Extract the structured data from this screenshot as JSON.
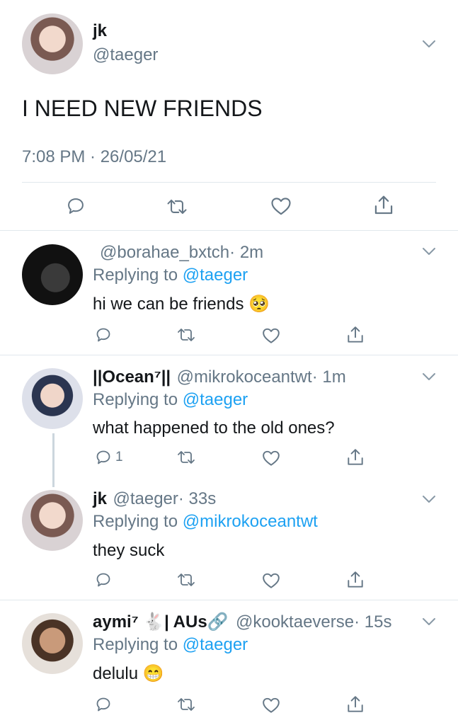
{
  "main_tweet": {
    "name": "jk",
    "handle": "@taeger",
    "text": "I NEED NEW FRIENDS",
    "timestamp": "7:08 PM · 26/05/21"
  },
  "replies": [
    {
      "name": "",
      "handle": "@borahae_bxtch",
      "time": "· 2m",
      "replying_prefix": "Replying to",
      "replying_to": "@taeger",
      "text": "hi we can be friends",
      "emoji": "🥺",
      "reply_count": ""
    },
    {
      "name": "||Ocean⁷||",
      "handle": "@mikrokoceantwt",
      "time": "· 1m",
      "replying_prefix": "Replying to",
      "replying_to": "@taeger",
      "text": "what happened to the old ones?",
      "emoji": "",
      "reply_count": "1"
    },
    {
      "name": "jk",
      "handle": "@taeger",
      "time": "· 33s",
      "replying_prefix": "Replying to",
      "replying_to": "@mikrokoceantwt",
      "text": "they suck",
      "emoji": "",
      "reply_count": ""
    },
    {
      "name": "aymi⁷ 🐇| AUs🔗",
      "handle": "@kooktaeverse",
      "time": "· 15s",
      "replying_prefix": "Replying to",
      "replying_to": "@taeger",
      "text": "delulu",
      "emoji": "😁",
      "reply_count": ""
    }
  ],
  "icons": {
    "reply": "reply-icon",
    "retweet": "retweet-icon",
    "like": "like-icon",
    "share": "share-icon",
    "more": "chevron-down-icon"
  },
  "colors": {
    "link": "#1da1f2",
    "secondary": "#657786",
    "divider": "#e1e8ed",
    "text": "#14171a"
  }
}
